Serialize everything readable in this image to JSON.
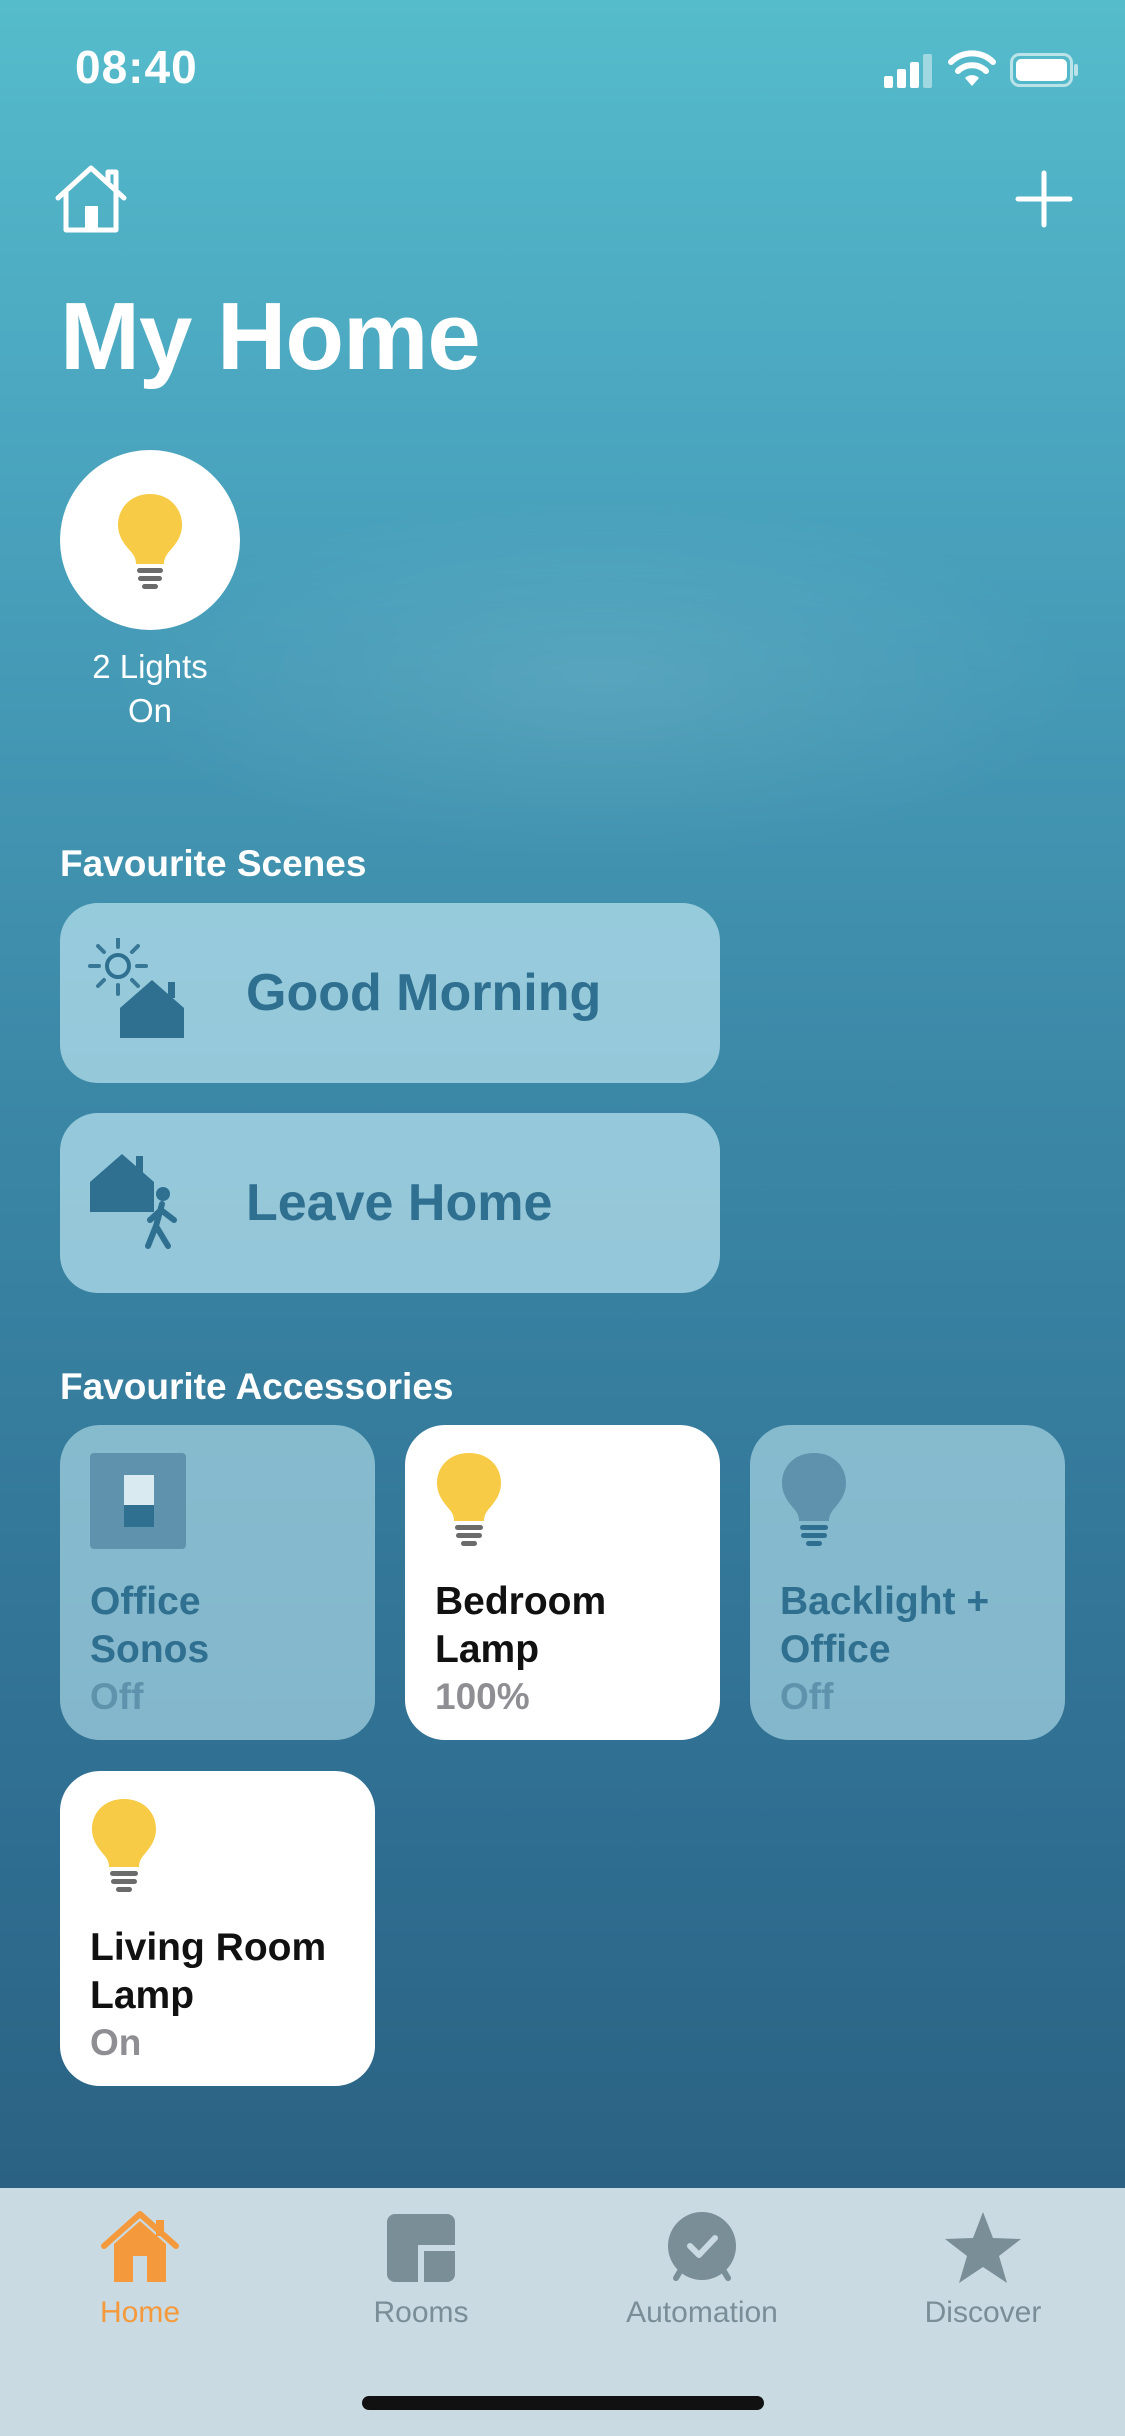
{
  "status_bar": {
    "time": "08:40"
  },
  "header": {
    "title": "My Home"
  },
  "status": {
    "line1": "2 Lights",
    "line2": "On"
  },
  "scenes": {
    "header": "Favourite Scenes",
    "items": [
      {
        "name": "Good Morning",
        "icon": "sunrise-house-icon"
      },
      {
        "name": "Leave Home",
        "icon": "house-walking-person-icon"
      }
    ]
  },
  "accessories": {
    "header": "Favourite Accessories",
    "items": [
      {
        "name_line1": "Office",
        "name_line2": "Sonos",
        "status": "Off",
        "state": "off",
        "icon": "switch-icon"
      },
      {
        "name_line1": "Bedroom",
        "name_line2": "Lamp",
        "status": "100%",
        "state": "on",
        "icon": "lightbulb-icon"
      },
      {
        "name_line1": "Backlight +",
        "name_line2": "Office",
        "status": "Off",
        "state": "off",
        "icon": "lightbulb-icon"
      },
      {
        "name_line1": "Living Room",
        "name_line2": "Lamp",
        "status": "On",
        "state": "on",
        "icon": "lightbulb-icon"
      }
    ]
  },
  "tabbar": {
    "items": [
      {
        "label": "Home",
        "icon": "home-icon",
        "active": true
      },
      {
        "label": "Rooms",
        "icon": "rooms-icon",
        "active": false
      },
      {
        "label": "Automation",
        "icon": "automation-icon",
        "active": false
      },
      {
        "label": "Discover",
        "icon": "star-icon",
        "active": false
      }
    ]
  },
  "colors": {
    "accent": "#f49a3c",
    "bulb_on": "#f7cb45",
    "scene_text": "#2f6f90",
    "tab_inactive": "#7a8e98"
  }
}
